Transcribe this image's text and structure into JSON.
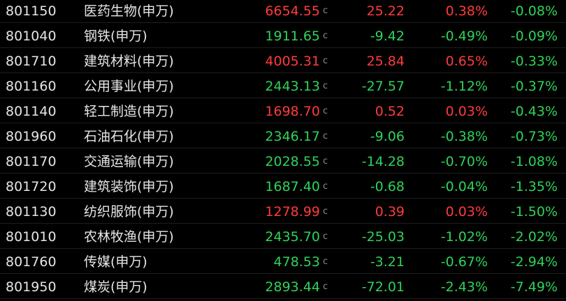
{
  "colors": {
    "up": "#ff3b3b",
    "down": "#2fd35a",
    "text": "#e6e6e6",
    "background": "#000000"
  },
  "rows": [
    {
      "code": "801150",
      "name": "医药生物(申万)",
      "price": "6654.55",
      "flag": "c",
      "change": "25.22",
      "pct": "0.38%",
      "pct2": "-0.08%",
      "dir": "up"
    },
    {
      "code": "801040",
      "name": "钢铁(申万)",
      "price": "1911.65",
      "flag": "c",
      "change": "-9.42",
      "pct": "-0.49%",
      "pct2": "-0.09%",
      "dir": "down"
    },
    {
      "code": "801710",
      "name": "建筑材料(申万)",
      "price": "4005.31",
      "flag": "c",
      "change": "25.84",
      "pct": "0.65%",
      "pct2": "-0.33%",
      "dir": "up"
    },
    {
      "code": "801160",
      "name": "公用事业(申万)",
      "price": "2443.13",
      "flag": "c",
      "change": "-27.57",
      "pct": "-1.12%",
      "pct2": "-0.37%",
      "dir": "down"
    },
    {
      "code": "801140",
      "name": "轻工制造(申万)",
      "price": "1698.70",
      "flag": "c",
      "change": "0.52",
      "pct": "0.03%",
      "pct2": "-0.43%",
      "dir": "up"
    },
    {
      "code": "801960",
      "name": "石油石化(申万)",
      "price": "2346.17",
      "flag": "c",
      "change": "-9.06",
      "pct": "-0.38%",
      "pct2": "-0.73%",
      "dir": "down"
    },
    {
      "code": "801170",
      "name": "交通运输(申万)",
      "price": "2028.55",
      "flag": "c",
      "change": "-14.28",
      "pct": "-0.70%",
      "pct2": "-1.08%",
      "dir": "down"
    },
    {
      "code": "801720",
      "name": "建筑装饰(申万)",
      "price": "1687.40",
      "flag": "c",
      "change": "-0.68",
      "pct": "-0.04%",
      "pct2": "-1.35%",
      "dir": "down"
    },
    {
      "code": "801130",
      "name": "纺织服饰(申万)",
      "price": "1278.99",
      "flag": "c",
      "change": "0.39",
      "pct": "0.03%",
      "pct2": "-1.50%",
      "dir": "up"
    },
    {
      "code": "801010",
      "name": "农林牧渔(申万)",
      "price": "2435.70",
      "flag": "c",
      "change": "-25.03",
      "pct": "-1.02%",
      "pct2": "-2.02%",
      "dir": "down"
    },
    {
      "code": "801760",
      "name": "传媒(申万)",
      "price": "478.53",
      "flag": "c",
      "change": "-3.21",
      "pct": "-0.67%",
      "pct2": "-2.94%",
      "dir": "down"
    },
    {
      "code": "801950",
      "name": "煤炭(申万)",
      "price": "2893.44",
      "flag": "c",
      "change": "-72.01",
      "pct": "-2.43%",
      "pct2": "-7.49%",
      "dir": "down"
    }
  ]
}
